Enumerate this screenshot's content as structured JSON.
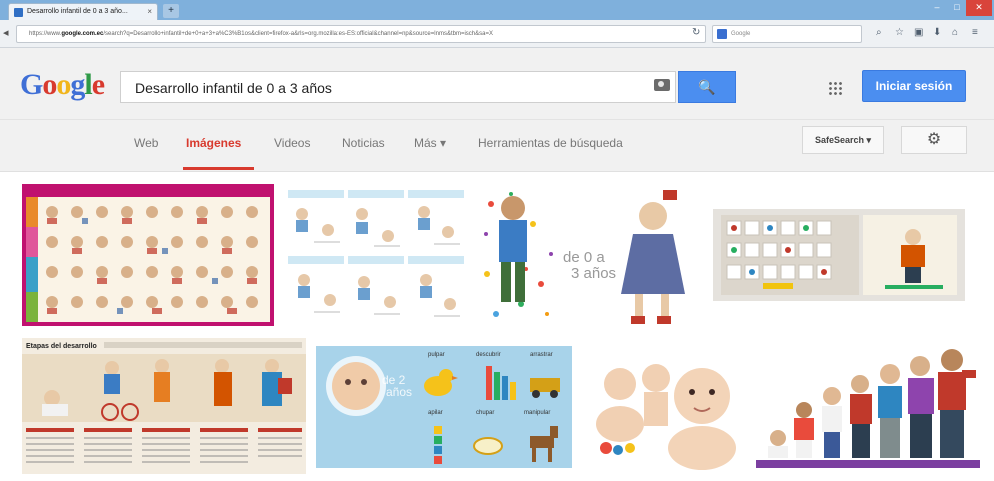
{
  "browser": {
    "tab_title": "Desarrollo infantil de 0 a 3 año...",
    "tab_close": "×",
    "new_tab": "+",
    "url_prefix": "https://www.",
    "url_host": "google.com.ec",
    "url_rest": "/search?q=Desarrollo+infantil+de+0+a+3+a%C3%B1os&client=firefox-a&rls=org.mozilla:es-ES:official&channel=np&source=lnms&tbm=isch&sa=X",
    "search_engine_placeholder": "Google",
    "win_minimize": "–",
    "win_maximize": "□",
    "win_close": "✕"
  },
  "google": {
    "logo": [
      "G",
      "o",
      "o",
      "g",
      "l",
      "e"
    ],
    "query": "Desarrollo infantil de 0 a 3 años",
    "search_button_icon": "🔍",
    "signin_label": "Iniciar sesión"
  },
  "filters": {
    "tabs": [
      "Web",
      "Imágenes",
      "Videos",
      "Noticias",
      "Más ▾",
      "Herramientas de búsqueda"
    ],
    "active_tab": "Imágenes",
    "safesearch_label": "SafeSearch ▾",
    "settings_icon": "⚙"
  },
  "image_text": {
    "ages": "de 0 a\n3 años",
    "etapas": "Etapas del desarrollo",
    "sensory_labels": [
      "pulpar",
      "descubrir",
      "arrastrar",
      "apilar",
      "chupar",
      "manipular"
    ]
  },
  "colors": {
    "brand_blue": "#4b8ef0",
    "active_red": "#d83a2e"
  }
}
